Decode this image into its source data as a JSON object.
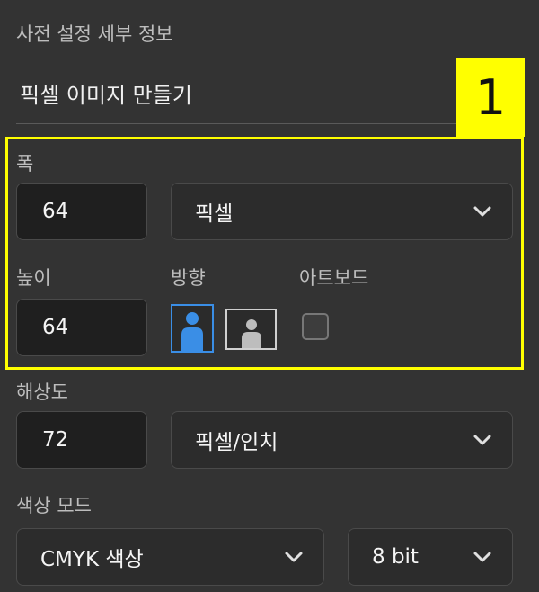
{
  "preset": {
    "title": "사전 설정 세부 정보",
    "name_value": "픽셀 이미지 만들기"
  },
  "annotation": {
    "badge": "1",
    "highlight_color": "#ffff00"
  },
  "width": {
    "label": "폭",
    "value": "64",
    "unit": "픽셀"
  },
  "height": {
    "label": "높이",
    "value": "64"
  },
  "orientation": {
    "label": "방향",
    "options": [
      "portrait-icon",
      "landscape-icon"
    ],
    "selected": "portrait",
    "accent": "#3a8ee6"
  },
  "artboard": {
    "label": "아트보드",
    "checked": false
  },
  "resolution": {
    "label": "해상도",
    "value": "72",
    "unit": "픽셀/인치"
  },
  "color_mode": {
    "label": "색상 모드",
    "mode": "CMYK 색상",
    "depth": "8 bit"
  }
}
